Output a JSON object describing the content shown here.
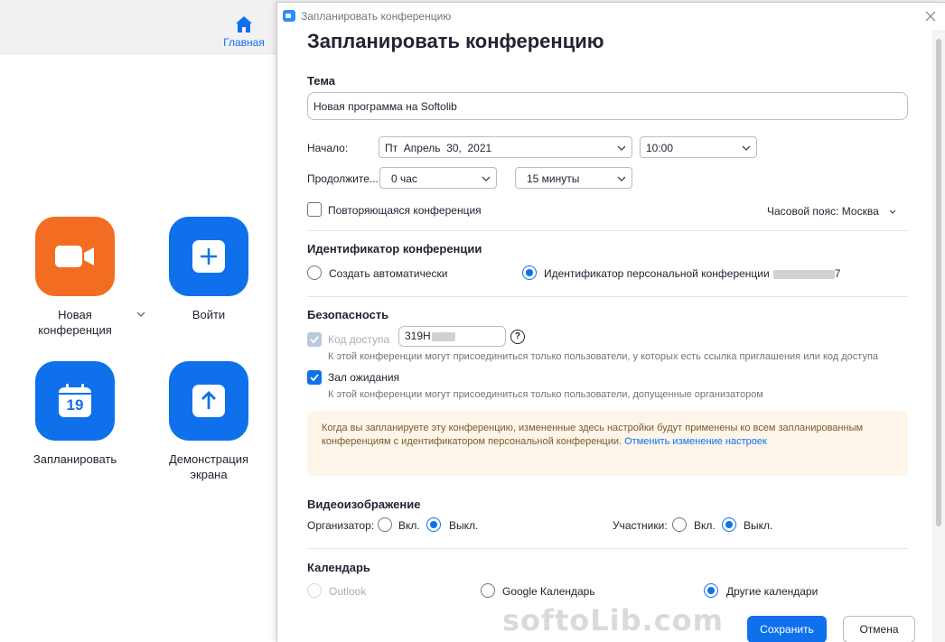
{
  "main": {
    "home_label": "Главная",
    "tiles": {
      "new_meeting": "Новая конференция",
      "join": "Войти",
      "schedule": "Запланировать",
      "schedule_day": "19",
      "share_screen": "Демонстрация экрана"
    }
  },
  "dialog": {
    "window_title": "Запланировать конференцию",
    "heading": "Запланировать конференцию",
    "topic": {
      "label": "Тема",
      "value": "Новая программа на Softolib"
    },
    "start": {
      "label": "Начало:",
      "date": "Пт  Апрель  30,  2021",
      "time": "10:00"
    },
    "duration": {
      "label": "Продолжите...",
      "hours": "0 час",
      "minutes": "15 минуты"
    },
    "recurring": {
      "label": "Повторяющаяся конференция",
      "checked": false
    },
    "timezone": "Часовой пояс: Москва",
    "meeting_id": {
      "title": "Идентификатор конференции",
      "auto_label": "Создать автоматически",
      "personal_label": "Идентификатор персональной конференции",
      "personal_id_visible": "7",
      "selected": "personal"
    },
    "security": {
      "title": "Безопасность",
      "passcode_label": "Код доступа",
      "passcode_value": "319H",
      "passcode_hint": "К этой конференции могут присоединиться только пользователи, у которых есть ссылка приглашения или код доступа",
      "waiting_room_label": "Зал ожидания",
      "waiting_room_hint": "К этой конференции могут присоединиться только пользователи, допущенные организатором"
    },
    "notice": {
      "text": "Когда вы запланируете эту конференцию, измененные здесь настройки будут применены ко всем запланированным конференциям с идентификатором персональной конференции. ",
      "link": "Отменить изменение настроек"
    },
    "video": {
      "title": "Видеоизображение",
      "host_label": "Организатор:",
      "participants_label": "Участники:",
      "on_label": "Вкл.",
      "off_label": "Выкл.",
      "host": "off",
      "participants": "off"
    },
    "calendar": {
      "title": "Календарь",
      "outlook": "Outlook",
      "google": "Google Календарь",
      "other": "Другие календари",
      "selected": "other"
    },
    "save_label": "Сохранить",
    "cancel_label": "Отмена"
  },
  "watermark": "softoLib.com",
  "colors": {
    "accent": "#0e71eb",
    "orange": "#f26d21",
    "notice_bg": "#fdf5ea"
  }
}
